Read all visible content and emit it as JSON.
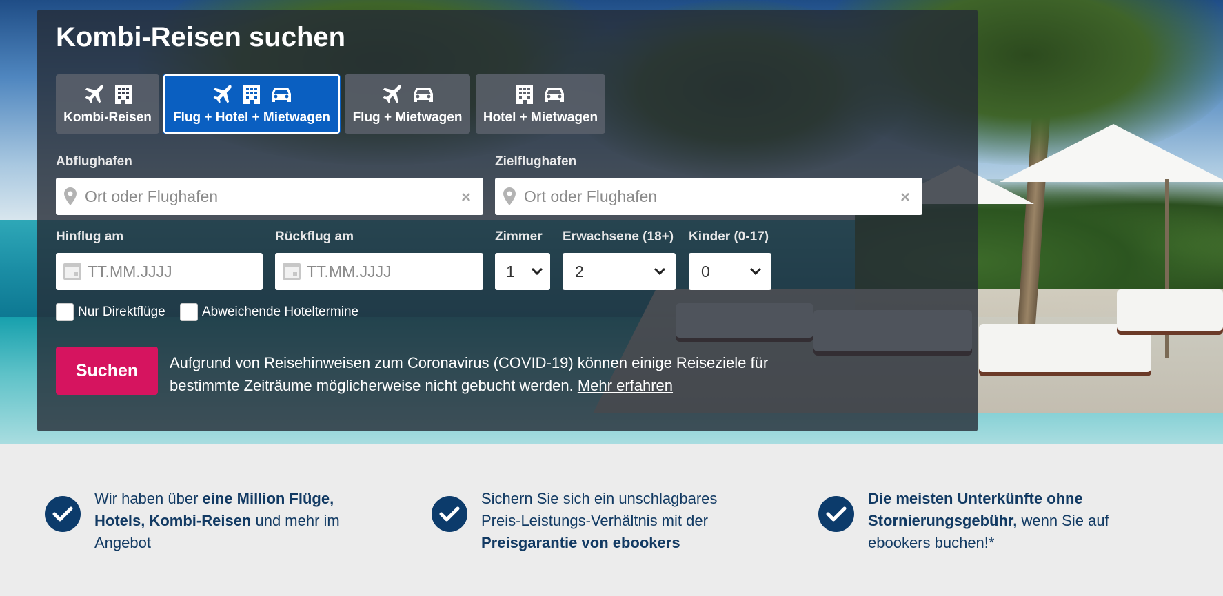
{
  "search": {
    "title": "Kombi-Reisen suchen",
    "tabs": [
      {
        "label": "Kombi-Reisen",
        "icons": [
          "plane-icon",
          "hotel-icon"
        ],
        "active": false
      },
      {
        "label": "Flug + Hotel + Mietwagen",
        "icons": [
          "plane-icon",
          "hotel-icon",
          "car-icon"
        ],
        "active": true
      },
      {
        "label": "Flug + Mietwagen",
        "icons": [
          "plane-icon",
          "car-icon"
        ],
        "active": false
      },
      {
        "label": "Hotel + Mietwagen",
        "icons": [
          "hotel-icon",
          "car-icon"
        ],
        "active": false
      }
    ],
    "origin": {
      "label": "Abflughafen",
      "placeholder": "Ort oder Flughafen",
      "value": ""
    },
    "destination": {
      "label": "Zielflughafen",
      "placeholder": "Ort oder Flughafen",
      "value": ""
    },
    "depart": {
      "label": "Hinflug am",
      "placeholder": "TT.MM.JJJJ"
    },
    "return": {
      "label": "Rückflug am",
      "placeholder": "TT.MM.JJJJ"
    },
    "rooms": {
      "label": "Zimmer",
      "value": "1"
    },
    "adults": {
      "label": "Erwachsene (18+)",
      "value": "2"
    },
    "children": {
      "label": "Kinder (0-17)",
      "value": "0"
    },
    "direct_only": {
      "label": "Nur Direktflüge",
      "checked": false
    },
    "different_hotel_dates": {
      "label": "Abweichende Hoteltermine",
      "checked": false
    },
    "submit_label": "Suchen",
    "notice": {
      "text": "Aufgrund von Reisehinweisen zum Coronavirus (COVID-19) können einige Reiseziele für bestimmte Zeiträume möglicherweise nicht gebucht werden.",
      "link_text": "Mehr erfahren"
    },
    "clear_glyph": "×"
  },
  "usps": [
    {
      "pre": "Wir haben über ",
      "bold": "eine Million Flüge, Hotels, Kombi-Reisen",
      "post": " und mehr im Angebot"
    },
    {
      "pre": "Sichern Sie sich ein unschlagbares Preis-Leistungs-Verhältnis mit der ",
      "bold": "Preisgarantie von ebookers",
      "post": ""
    },
    {
      "pre": "",
      "bold": "Die meisten Unterkünfte ohne Stornierungsgebühr,",
      "post": " wenn Sie auf ebookers buchen!*"
    }
  ],
  "colors": {
    "active_tab": "#0a5fc1",
    "search_button": "#d6145f",
    "usp_check": "#0c3b6b",
    "usp_text": "#123a63"
  }
}
